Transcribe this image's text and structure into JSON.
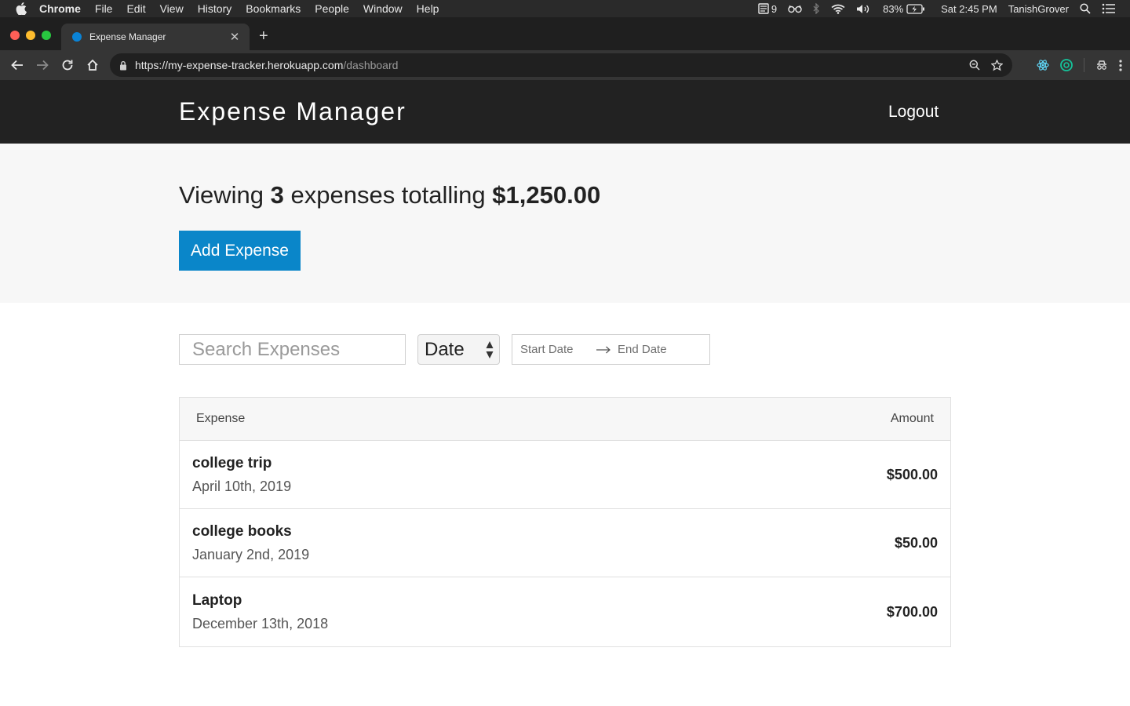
{
  "menubar": {
    "app_name": "Chrome",
    "items": [
      "File",
      "Edit",
      "View",
      "History",
      "Bookmarks",
      "People",
      "Window",
      "Help"
    ],
    "status": {
      "badge_count": "9",
      "battery": "83%",
      "clock": "Sat 2:45 PM",
      "user": "TanishGrover"
    }
  },
  "browser": {
    "tab_title": "Expense Manager",
    "url_scheme": "https://",
    "url_host": "my-expense-tracker.herokuapp.com",
    "url_path": "/dashboard"
  },
  "app": {
    "title": "Expense Manager",
    "logout_label": "Logout"
  },
  "summary": {
    "prefix": "Viewing ",
    "count": "3",
    "middle": " expenses totalling ",
    "total": "$1,250.00",
    "add_button_label": "Add Expense"
  },
  "filters": {
    "search_placeholder": "Search Expenses",
    "sort_value": "Date",
    "start_date_placeholder": "Start Date",
    "end_date_placeholder": "End Date"
  },
  "table": {
    "header_expense": "Expense",
    "header_amount": "Amount",
    "rows": [
      {
        "description": "college trip",
        "date": "April 10th, 2019",
        "amount": "$500.00"
      },
      {
        "description": "college books",
        "date": "January 2nd, 2019",
        "amount": "$50.00"
      },
      {
        "description": "Laptop",
        "date": "December 13th, 2018",
        "amount": "$700.00"
      }
    ]
  },
  "colors": {
    "header_bg": "#222222",
    "summary_bg": "#f7f7f7",
    "button_blue": "#0a86c9"
  }
}
